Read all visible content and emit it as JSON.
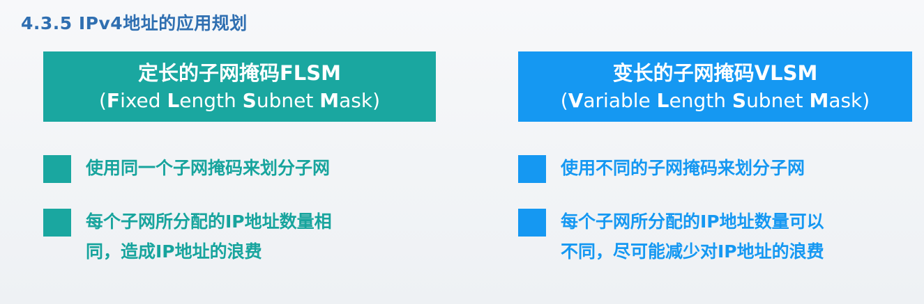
{
  "slide": {
    "title": "4.3.5 IPv4地址的应用规划"
  },
  "flsm": {
    "heading": "定长的子网掩码FLSM",
    "paren_open": "(",
    "f": "F",
    "ixed": "ixed ",
    "l": "L",
    "ength": "ength ",
    "s": "S",
    "ubnet": "ubnet ",
    "m": "M",
    "ask": "ask",
    "paren_close": ")",
    "bullet1": "使用同一个子网掩码来划分子网",
    "bullet2_line1": "每个子网所分配的IP地址数量相",
    "bullet2_line2": "同，造成IP地址的浪费",
    "color": "#1aa7a0"
  },
  "vlsm": {
    "heading": "变长的子网掩码VLSM",
    "paren_open": "(",
    "v": "V",
    "ariable": "ariable ",
    "l": "L",
    "ength": "ength ",
    "s": "S",
    "ubnet": "ubnet ",
    "m": "M",
    "ask": "ask",
    "paren_close": ")",
    "bullet1": "使用不同的子网掩码来划分子网",
    "bullet2_line1": "每个子网所分配的IP地址数量可以",
    "bullet2_line2": "不同，尽可能减少对IP地址的浪费",
    "color": "#1598f2"
  }
}
